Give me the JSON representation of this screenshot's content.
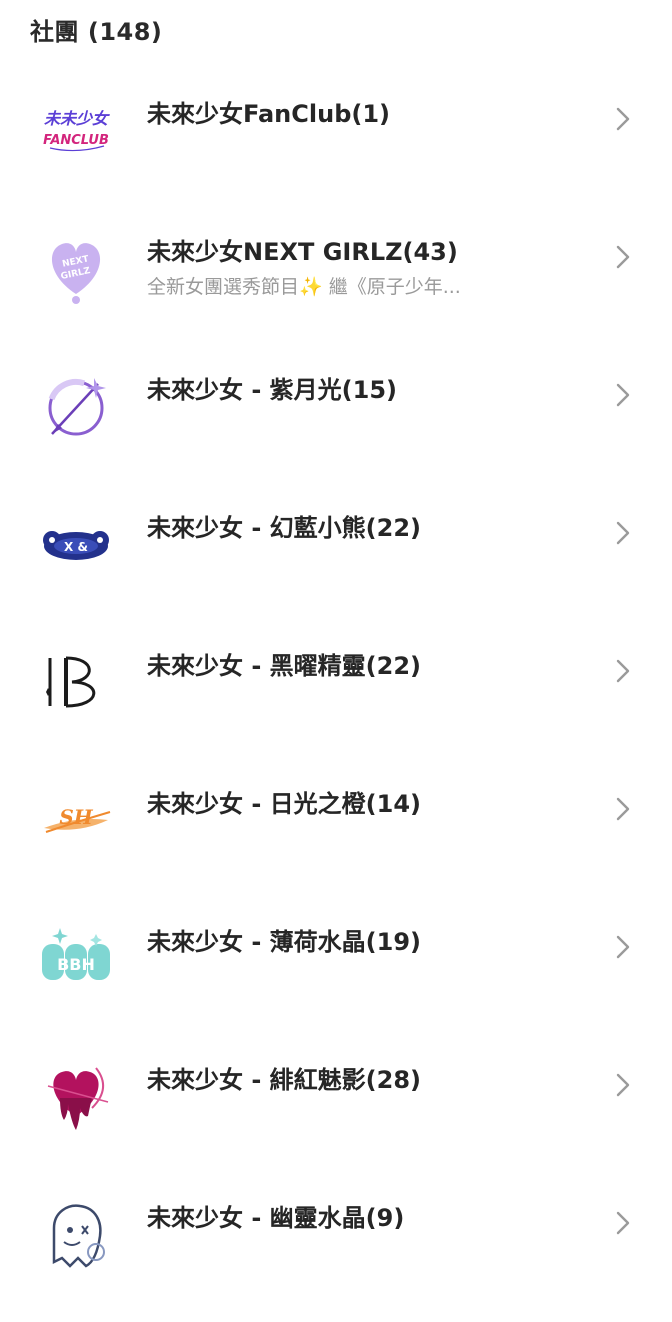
{
  "section": {
    "title": "社團 (148)"
  },
  "groups": [
    {
      "title": "未來少女FanClub(1)",
      "subtitle": "",
      "icon": "fanclub-logo-icon"
    },
    {
      "title": "未來少女NEXT GIRLZ(43)",
      "subtitle": "全新女團選秀節目✨ 繼《原子少年...",
      "icon": "next-girlz-heart-logo-icon"
    },
    {
      "title": "未來少女 - 紫月光(15)",
      "subtitle": "",
      "icon": "purple-moon-logo-icon"
    },
    {
      "title": "未來少女 - 幻藍小熊(22)",
      "subtitle": "",
      "icon": "blue-bear-logo-icon"
    },
    {
      "title": "未來少女 - 黑曜精靈(22)",
      "subtitle": "",
      "icon": "obsidian-elf-logo-icon"
    },
    {
      "title": "未來少女 - 日光之橙(14)",
      "subtitle": "",
      "icon": "sunlight-orange-logo-icon"
    },
    {
      "title": "未來少女 - 薄荷水晶(19)",
      "subtitle": "",
      "icon": "mint-crystal-logo-icon"
    },
    {
      "title": "未來少女 - 緋紅魅影(28)",
      "subtitle": "",
      "icon": "crimson-phantom-logo-icon"
    },
    {
      "title": "未來少女 - 幽靈水晶(9)",
      "subtitle": "",
      "icon": "ghost-crystal-logo-icon"
    }
  ],
  "colors": {
    "fanclub": "#5b3fd6",
    "fanclub_accent": "#d3257d",
    "lavender": "#c9b2f0",
    "purple": "#8a5fd0",
    "navy": "#23318c",
    "black": "#1b1b1b",
    "orange": "#f08a2e",
    "mint": "#7fd6d2",
    "crimson": "#b3125e",
    "chevron": "#9a9a9a"
  }
}
